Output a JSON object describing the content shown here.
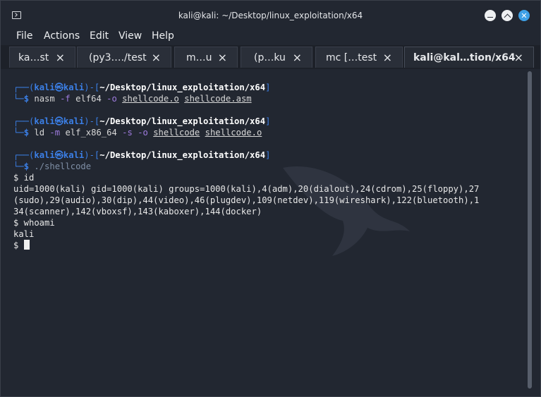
{
  "window": {
    "title": "kali@kali: ~/Desktop/linux_exploitation/x64"
  },
  "menu": {
    "items": [
      "File",
      "Actions",
      "Edit",
      "View",
      "Help"
    ]
  },
  "tabs": [
    {
      "label": "ka…st"
    },
    {
      "label": "(py3…./test"
    },
    {
      "label": "m…u"
    },
    {
      "label": "(p…ku"
    },
    {
      "label": "mc […test"
    },
    {
      "label": "kali@kal…tion/x64"
    }
  ],
  "terminal": {
    "prompt_top_left": "┌──(",
    "prompt_user": "kali㉿kali",
    "prompt_mid": ")-[",
    "prompt_path": "~/Desktop/linux_exploitation/x64",
    "prompt_end": "]",
    "prompt_bottom": "└─",
    "prompt_dollar": "$",
    "cmd1": {
      "bin": "nasm",
      "flag1": "-f",
      "arg1": "elf64",
      "flag2": "-o",
      "file1": "shellcode.o",
      "file2": "shellcode.asm"
    },
    "cmd2": {
      "bin": "ld",
      "flag1": "-m",
      "arg1": "elf_x86_64",
      "flag2": "-s",
      "flag3": "-o",
      "file1": "shellcode",
      "file2": "shellcode.o"
    },
    "cmd3": "./shellcode",
    "shell_lines": [
      "$ id",
      "uid=1000(kali) gid=1000(kali) groups=1000(kali),4(adm),20(dialout),24(cdrom),25(floppy),27",
      "(sudo),29(audio),30(dip),44(video),46(plugdev),109(netdev),119(wireshark),122(bluetooth),1",
      "34(scanner),142(vboxsf),143(kaboxer),144(docker)",
      "$ whoami",
      "kali"
    ],
    "last_prompt": "$ "
  }
}
